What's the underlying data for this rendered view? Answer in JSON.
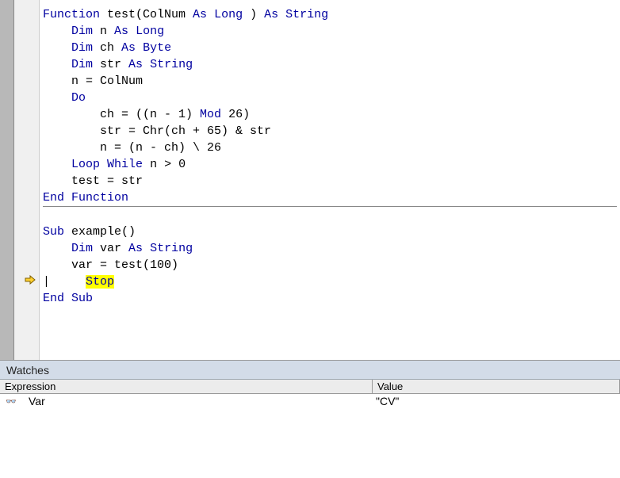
{
  "code": {
    "lines": [
      {
        "tokens": [
          [
            "kw",
            "Function"
          ],
          [
            "",
            " test(ColNum "
          ],
          [
            "kw",
            "As"
          ],
          [
            "",
            " "
          ],
          [
            "kw",
            "Long"
          ],
          [
            "",
            " ) "
          ],
          [
            "kw",
            "As"
          ],
          [
            "",
            " "
          ],
          [
            "kw",
            "String"
          ]
        ],
        "raw": "Function test(ColNum As Long) As String"
      },
      {
        "tokens": [
          [
            "",
            "    "
          ],
          [
            "kw",
            "Dim"
          ],
          [
            "",
            " n "
          ],
          [
            "kw",
            "As"
          ],
          [
            "",
            " "
          ],
          [
            "kw",
            "Long"
          ]
        ]
      },
      {
        "tokens": [
          [
            "",
            "    "
          ],
          [
            "kw",
            "Dim"
          ],
          [
            "",
            " ch "
          ],
          [
            "kw",
            "As"
          ],
          [
            "",
            " "
          ],
          [
            "kw",
            "Byte"
          ]
        ]
      },
      {
        "tokens": [
          [
            "",
            "    "
          ],
          [
            "kw",
            "Dim"
          ],
          [
            "",
            " str "
          ],
          [
            "kw",
            "As"
          ],
          [
            "",
            " "
          ],
          [
            "kw",
            "String"
          ]
        ]
      },
      {
        "tokens": [
          [
            "",
            ""
          ]
        ]
      },
      {
        "tokens": [
          [
            "",
            "    n = ColNum"
          ]
        ]
      },
      {
        "tokens": [
          [
            "",
            "    "
          ],
          [
            "kw",
            "Do"
          ]
        ]
      },
      {
        "tokens": [
          [
            "",
            "        ch = ((n - 1) "
          ],
          [
            "kw",
            "Mod"
          ],
          [
            "",
            " 26)"
          ]
        ]
      },
      {
        "tokens": [
          [
            "",
            "        str = Chr(ch + 65) & str"
          ]
        ]
      },
      {
        "tokens": [
          [
            "",
            "        n = (n - ch) \\ 26"
          ]
        ]
      },
      {
        "tokens": [
          [
            "",
            "    "
          ],
          [
            "kw",
            "Loop"
          ],
          [
            "",
            " "
          ],
          [
            "kw",
            "While"
          ],
          [
            "",
            " n > 0"
          ]
        ]
      },
      {
        "tokens": [
          [
            "",
            "    test = str"
          ]
        ]
      },
      {
        "tokens": [
          [
            "kw",
            "End"
          ],
          [
            "",
            " "
          ],
          [
            "kw",
            "Function"
          ]
        ]
      },
      {
        "divider": true
      },
      {
        "tokens": [
          [
            "kw",
            "Sub"
          ],
          [
            "",
            " example()"
          ]
        ]
      },
      {
        "tokens": [
          [
            "",
            "    "
          ],
          [
            "kw",
            "Dim"
          ],
          [
            "",
            " var "
          ],
          [
            "kw",
            "As"
          ],
          [
            "",
            " "
          ],
          [
            "kw",
            "String"
          ]
        ]
      },
      {
        "tokens": [
          [
            "",
            "    var = test(100)"
          ]
        ]
      },
      {
        "tokens": [
          [
            "",
            "    "
          ],
          [
            "hl-stop kw",
            "Stop"
          ]
        ],
        "current": true,
        "caret": true
      },
      {
        "tokens": [
          [
            "kw",
            "End"
          ],
          [
            "",
            " "
          ],
          [
            "kw",
            "Sub"
          ]
        ]
      }
    ]
  },
  "watches": {
    "title": "Watches",
    "columns": {
      "expression": "Expression",
      "value": "Value"
    },
    "rows": [
      {
        "icon": "👓",
        "expression": "Var",
        "value": "\"CV\""
      }
    ]
  }
}
